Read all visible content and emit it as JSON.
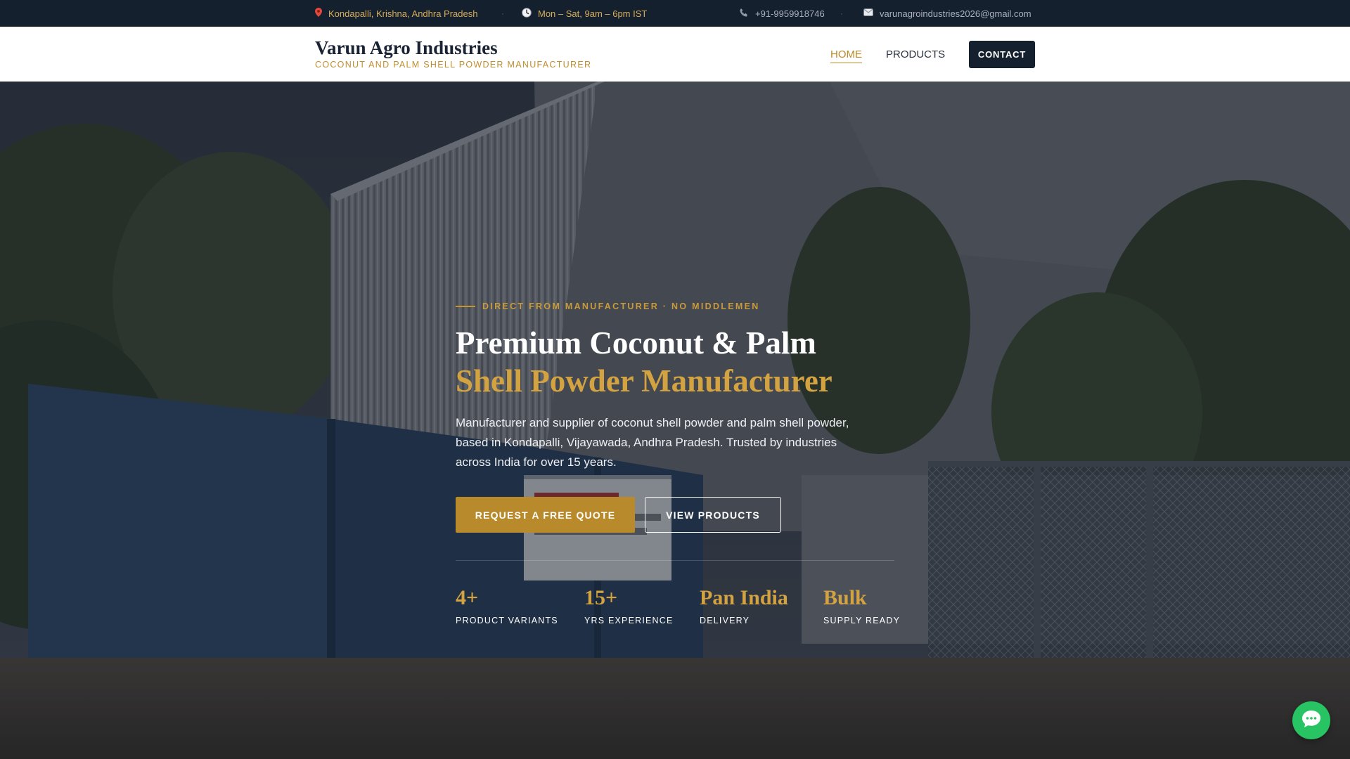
{
  "topbar": {
    "location": "Kondapalli, Krishna, Andhra Pradesh",
    "hours": "Mon – Sat, 9am – 6pm IST",
    "phone": "+91-9959918746",
    "email": "varunagroindustries2026@gmail.com",
    "separator": "·",
    "icons": [
      "pin-icon",
      "clock-icon",
      "phone-icon",
      "mail-icon"
    ]
  },
  "header": {
    "brand_name": "Varun Agro Industries",
    "brand_tagline": "COCONUT AND PALM SHELL POWDER MANUFACTURER",
    "nav": {
      "home": "HOME",
      "products": "PRODUCTS",
      "contact": "CONTACT"
    }
  },
  "hero": {
    "eyebrow": "DIRECT FROM MANUFACTURER · NO MIDDLEMEN",
    "title_line1": "Premium Coconut & Palm",
    "title_line2": "Shell Powder Manufacturer",
    "description": "Manufacturer and supplier of coconut shell powder and palm shell powder, based in Kondapalli, Vijayawada, Andhra Pradesh. Trusted by industries across India for over 15 years.",
    "primary_cta": "REQUEST A FREE QUOTE",
    "secondary_cta": "VIEW PRODUCTS",
    "stats": [
      {
        "value": "4+",
        "label": "PRODUCT VARIANTS"
      },
      {
        "value": "15+",
        "label": "YRS EXPERIENCE"
      },
      {
        "value": "Pan India",
        "label": "DELIVERY"
      },
      {
        "value": "Bulk",
        "label": "SUPPLY READY"
      }
    ]
  },
  "colors": {
    "accent": "#b88a2c",
    "navy": "#15202f",
    "chat_green": "#28c463"
  },
  "chat_widget": {
    "icon": "chat-bubble-icon"
  }
}
